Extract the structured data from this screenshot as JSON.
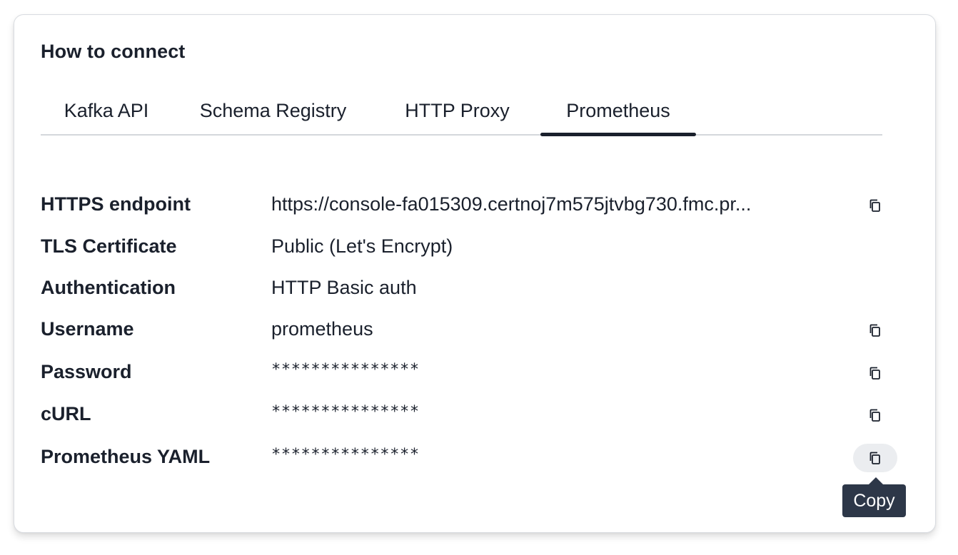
{
  "card": {
    "title": "How to connect"
  },
  "tabs": [
    {
      "label": "Kafka API",
      "active": false
    },
    {
      "label": "Schema Registry",
      "active": false
    },
    {
      "label": "HTTP Proxy",
      "active": false
    },
    {
      "label": "Prometheus",
      "active": true
    }
  ],
  "details": [
    {
      "label": "HTTPS endpoint",
      "value": "https://console-fa015309.certnoj7m575jtvbg730.fmc.pr...",
      "copyable": true
    },
    {
      "label": "TLS Certificate",
      "value": "Public (Let's Encrypt)",
      "copyable": false
    },
    {
      "label": "Authentication",
      "value": "HTTP Basic auth",
      "copyable": false
    },
    {
      "label": "Username",
      "value": "prometheus",
      "copyable": true
    },
    {
      "label": "Password",
      "value": "***************",
      "copyable": true
    },
    {
      "label": "cURL",
      "value": "***************",
      "copyable": true
    },
    {
      "label": "Prometheus YAML",
      "value": "***************",
      "copyable": true
    }
  ],
  "copy_icon": "copy-icon",
  "tooltip": {
    "text": "Copy"
  },
  "colors": {
    "text": "#1a202c",
    "active_tab_indicator": "#1a202c",
    "tooltip_bg": "#2d3748",
    "hover_bg": "#ebedf0"
  }
}
